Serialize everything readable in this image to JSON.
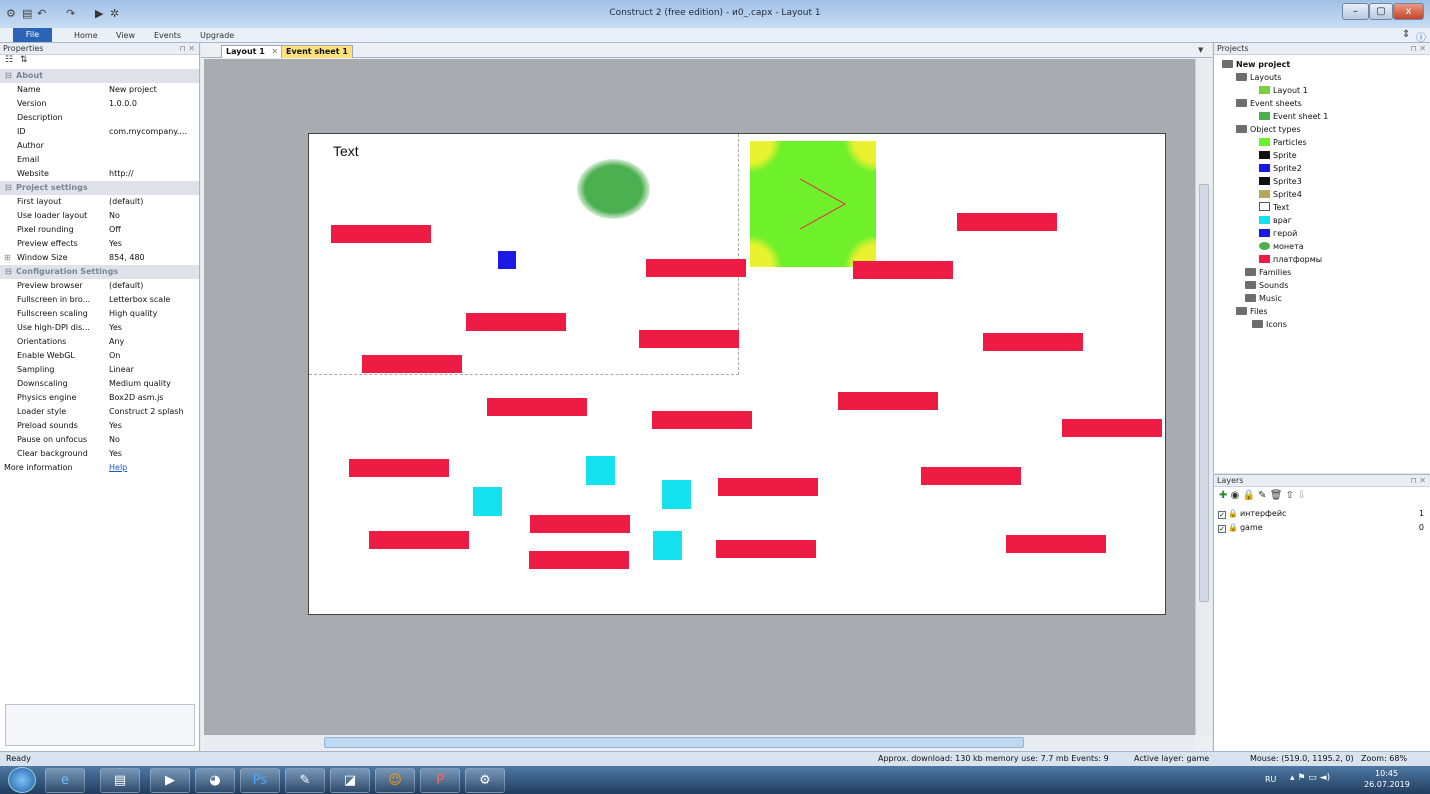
{
  "window": {
    "title": "Construct 2  (free edition) - и0_.capx - Layout 1",
    "buttons": [
      "–",
      "▢",
      "x"
    ]
  },
  "ribbon": {
    "tabs": [
      "File",
      "Home",
      "View",
      "Events",
      "Upgrade"
    ]
  },
  "properties": {
    "panel_title": "Properties",
    "sections": [
      {
        "name": "About",
        "rows": [
          {
            "k": "Name",
            "v": "New project"
          },
          {
            "k": "Version",
            "v": "1.0.0.0"
          },
          {
            "k": "Description",
            "v": ""
          },
          {
            "k": "ID",
            "v": "com.mycompany...."
          },
          {
            "k": "Author",
            "v": ""
          },
          {
            "k": "Email",
            "v": ""
          },
          {
            "k": "Website",
            "v": "http://"
          }
        ]
      },
      {
        "name": "Project settings",
        "rows": [
          {
            "k": "First layout",
            "v": "(default)"
          },
          {
            "k": "Use loader layout",
            "v": "No"
          },
          {
            "k": "Pixel rounding",
            "v": "Off"
          },
          {
            "k": "Preview effects",
            "v": "Yes"
          },
          {
            "k": "Window Size",
            "v": "854, 480"
          }
        ]
      },
      {
        "name": "Configuration Settings",
        "rows": [
          {
            "k": "Preview browser",
            "v": "(default)"
          },
          {
            "k": "Fullscreen in bro...",
            "v": "Letterbox scale"
          },
          {
            "k": "Fullscreen scaling",
            "v": "High quality"
          },
          {
            "k": "Use high-DPI dis...",
            "v": "Yes"
          },
          {
            "k": "Orientations",
            "v": "Any"
          },
          {
            "k": "Enable WebGL",
            "v": "On"
          },
          {
            "k": "Sampling",
            "v": "Linear"
          },
          {
            "k": "Downscaling",
            "v": "Medium quality"
          },
          {
            "k": "Physics engine",
            "v": "Box2D asm.js"
          },
          {
            "k": "Loader style",
            "v": "Construct 2 splash"
          },
          {
            "k": "Preload sounds",
            "v": "Yes"
          },
          {
            "k": "Pause on unfocus",
            "v": "No"
          },
          {
            "k": "Clear background",
            "v": "Yes"
          }
        ]
      }
    ],
    "more_info_label": "More information",
    "help_link": "Help"
  },
  "doc_tabs": [
    "Layout 1",
    "Event sheet 1"
  ],
  "layout": {
    "text_object": "Text"
  },
  "projects": {
    "panel_title": "Projects",
    "tree": {
      "root": "New project",
      "layouts_folder": "Layouts",
      "layout1": "Layout 1",
      "events_folder": "Event sheets",
      "event_sheet1": "Event sheet 1",
      "objects_folder": "Object types",
      "objects": [
        "Particles",
        "Sprite",
        "Sprite2",
        "Sprite3",
        "Sprite4",
        "Text",
        "враг",
        "герой",
        "монета",
        "платформы"
      ],
      "families": "Families",
      "sounds": "Sounds",
      "music": "Music",
      "files": "Files",
      "icons": "Icons"
    }
  },
  "layers": {
    "panel_title": "Layers",
    "rows": [
      {
        "name": "интерфейс",
        "index": "1"
      },
      {
        "name": "game",
        "index": "0"
      }
    ]
  },
  "status": {
    "ready": "Ready",
    "download": "Approx. download: 130 kb  memory use: 7.7 mb  Events: 9",
    "active_layer": "Active layer: game",
    "mouse": "Mouse: (519.0, 1195.2, 0)",
    "zoom": "Zoom: 68%"
  },
  "taskbar": {
    "lang": "RU",
    "time": "10:45",
    "date": "26.07.2019"
  },
  "colors": {
    "platform": "#ee1b44",
    "enemy": "#14e2ee",
    "hero": "#1a1ae6",
    "coin": "#4caf50",
    "accent": "#2b64b6"
  }
}
